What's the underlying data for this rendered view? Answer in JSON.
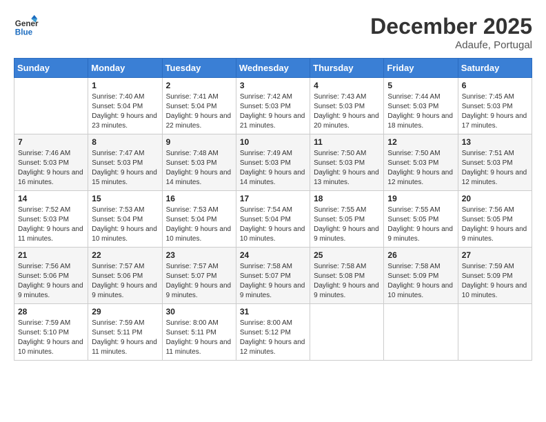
{
  "header": {
    "logo_line1": "General",
    "logo_line2": "Blue",
    "month": "December 2025",
    "location": "Adaufe, Portugal"
  },
  "weekdays": [
    "Sunday",
    "Monday",
    "Tuesday",
    "Wednesday",
    "Thursday",
    "Friday",
    "Saturday"
  ],
  "weeks": [
    [
      {
        "day": "",
        "sunrise": "",
        "sunset": "",
        "daylight": ""
      },
      {
        "day": "1",
        "sunrise": "7:40 AM",
        "sunset": "5:04 PM",
        "daylight": "9 hours and 23 minutes."
      },
      {
        "day": "2",
        "sunrise": "7:41 AM",
        "sunset": "5:04 PM",
        "daylight": "9 hours and 22 minutes."
      },
      {
        "day": "3",
        "sunrise": "7:42 AM",
        "sunset": "5:03 PM",
        "daylight": "9 hours and 21 minutes."
      },
      {
        "day": "4",
        "sunrise": "7:43 AM",
        "sunset": "5:03 PM",
        "daylight": "9 hours and 20 minutes."
      },
      {
        "day": "5",
        "sunrise": "7:44 AM",
        "sunset": "5:03 PM",
        "daylight": "9 hours and 18 minutes."
      },
      {
        "day": "6",
        "sunrise": "7:45 AM",
        "sunset": "5:03 PM",
        "daylight": "9 hours and 17 minutes."
      }
    ],
    [
      {
        "day": "7",
        "sunrise": "7:46 AM",
        "sunset": "5:03 PM",
        "daylight": "9 hours and 16 minutes."
      },
      {
        "day": "8",
        "sunrise": "7:47 AM",
        "sunset": "5:03 PM",
        "daylight": "9 hours and 15 minutes."
      },
      {
        "day": "9",
        "sunrise": "7:48 AM",
        "sunset": "5:03 PM",
        "daylight": "9 hours and 14 minutes."
      },
      {
        "day": "10",
        "sunrise": "7:49 AM",
        "sunset": "5:03 PM",
        "daylight": "9 hours and 14 minutes."
      },
      {
        "day": "11",
        "sunrise": "7:50 AM",
        "sunset": "5:03 PM",
        "daylight": "9 hours and 13 minutes."
      },
      {
        "day": "12",
        "sunrise": "7:50 AM",
        "sunset": "5:03 PM",
        "daylight": "9 hours and 12 minutes."
      },
      {
        "day": "13",
        "sunrise": "7:51 AM",
        "sunset": "5:03 PM",
        "daylight": "9 hours and 12 minutes."
      }
    ],
    [
      {
        "day": "14",
        "sunrise": "7:52 AM",
        "sunset": "5:03 PM",
        "daylight": "9 hours and 11 minutes."
      },
      {
        "day": "15",
        "sunrise": "7:53 AM",
        "sunset": "5:04 PM",
        "daylight": "9 hours and 10 minutes."
      },
      {
        "day": "16",
        "sunrise": "7:53 AM",
        "sunset": "5:04 PM",
        "daylight": "9 hours and 10 minutes."
      },
      {
        "day": "17",
        "sunrise": "7:54 AM",
        "sunset": "5:04 PM",
        "daylight": "9 hours and 10 minutes."
      },
      {
        "day": "18",
        "sunrise": "7:55 AM",
        "sunset": "5:05 PM",
        "daylight": "9 hours and 9 minutes."
      },
      {
        "day": "19",
        "sunrise": "7:55 AM",
        "sunset": "5:05 PM",
        "daylight": "9 hours and 9 minutes."
      },
      {
        "day": "20",
        "sunrise": "7:56 AM",
        "sunset": "5:05 PM",
        "daylight": "9 hours and 9 minutes."
      }
    ],
    [
      {
        "day": "21",
        "sunrise": "7:56 AM",
        "sunset": "5:06 PM",
        "daylight": "9 hours and 9 minutes."
      },
      {
        "day": "22",
        "sunrise": "7:57 AM",
        "sunset": "5:06 PM",
        "daylight": "9 hours and 9 minutes."
      },
      {
        "day": "23",
        "sunrise": "7:57 AM",
        "sunset": "5:07 PM",
        "daylight": "9 hours and 9 minutes."
      },
      {
        "day": "24",
        "sunrise": "7:58 AM",
        "sunset": "5:07 PM",
        "daylight": "9 hours and 9 minutes."
      },
      {
        "day": "25",
        "sunrise": "7:58 AM",
        "sunset": "5:08 PM",
        "daylight": "9 hours and 9 minutes."
      },
      {
        "day": "26",
        "sunrise": "7:58 AM",
        "sunset": "5:09 PM",
        "daylight": "9 hours and 10 minutes."
      },
      {
        "day": "27",
        "sunrise": "7:59 AM",
        "sunset": "5:09 PM",
        "daylight": "9 hours and 10 minutes."
      }
    ],
    [
      {
        "day": "28",
        "sunrise": "7:59 AM",
        "sunset": "5:10 PM",
        "daylight": "9 hours and 10 minutes."
      },
      {
        "day": "29",
        "sunrise": "7:59 AM",
        "sunset": "5:11 PM",
        "daylight": "9 hours and 11 minutes."
      },
      {
        "day": "30",
        "sunrise": "8:00 AM",
        "sunset": "5:11 PM",
        "daylight": "9 hours and 11 minutes."
      },
      {
        "day": "31",
        "sunrise": "8:00 AM",
        "sunset": "5:12 PM",
        "daylight": "9 hours and 12 minutes."
      },
      {
        "day": "",
        "sunrise": "",
        "sunset": "",
        "daylight": ""
      },
      {
        "day": "",
        "sunrise": "",
        "sunset": "",
        "daylight": ""
      },
      {
        "day": "",
        "sunrise": "",
        "sunset": "",
        "daylight": ""
      }
    ]
  ]
}
